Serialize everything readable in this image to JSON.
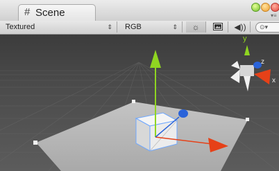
{
  "window": {
    "tab_title": "Scene",
    "tab_icon": "grid-icon",
    "traffic_lights": [
      "#6fbf2a",
      "#f0a030",
      "#e0453a"
    ]
  },
  "toolbar": {
    "draw_mode": "Textured",
    "render_mode": "RGB",
    "buttons": [
      "sun-lighting-icon",
      "image-icon",
      "audio-icon"
    ],
    "search_icon": "search-icon"
  },
  "gizmo": {
    "axis_labels": {
      "y": "y",
      "z": "z",
      "x": "x"
    },
    "axis_colors": {
      "x": "#e64118",
      "y": "#8fd521",
      "z": "#2a63d9"
    }
  },
  "scene": {
    "background_top": "#3a3a3a",
    "plane_color": "#bcbcbc",
    "cube_color": "#e8e8e8"
  }
}
